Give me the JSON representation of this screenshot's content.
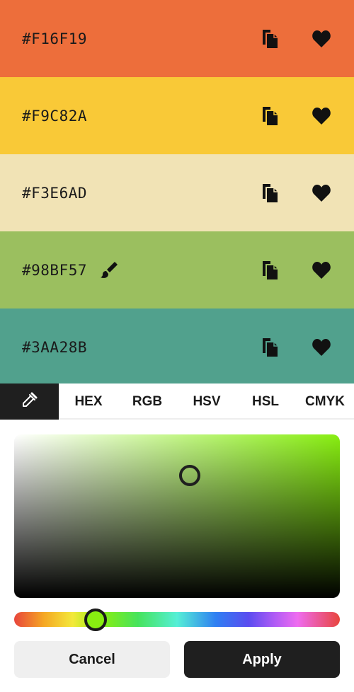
{
  "swatches": [
    {
      "hex": "#F16F19",
      "bg": "#ED6E3B",
      "editing": false
    },
    {
      "hex": "#F9C82A",
      "bg": "#F9C937",
      "editing": false
    },
    {
      "hex": "#F3E6AD",
      "bg": "#F1E3B5",
      "editing": false
    },
    {
      "hex": "#98BF57",
      "bg": "#9BBF5F",
      "editing": true
    },
    {
      "hex": "#3AA28B",
      "bg": "#51A18D",
      "editing": false
    }
  ],
  "icons": {
    "copy": "copy-icon",
    "favorite": "heart-icon",
    "edit": "brush-icon",
    "eyedropper": "eyedropper-icon"
  },
  "tabs": [
    "HEX",
    "RGB",
    "HSV",
    "HSL",
    "CMYK"
  ],
  "picker": {
    "hue_color": "#88EE11"
  },
  "buttons": {
    "cancel": "Cancel",
    "apply": "Apply"
  }
}
